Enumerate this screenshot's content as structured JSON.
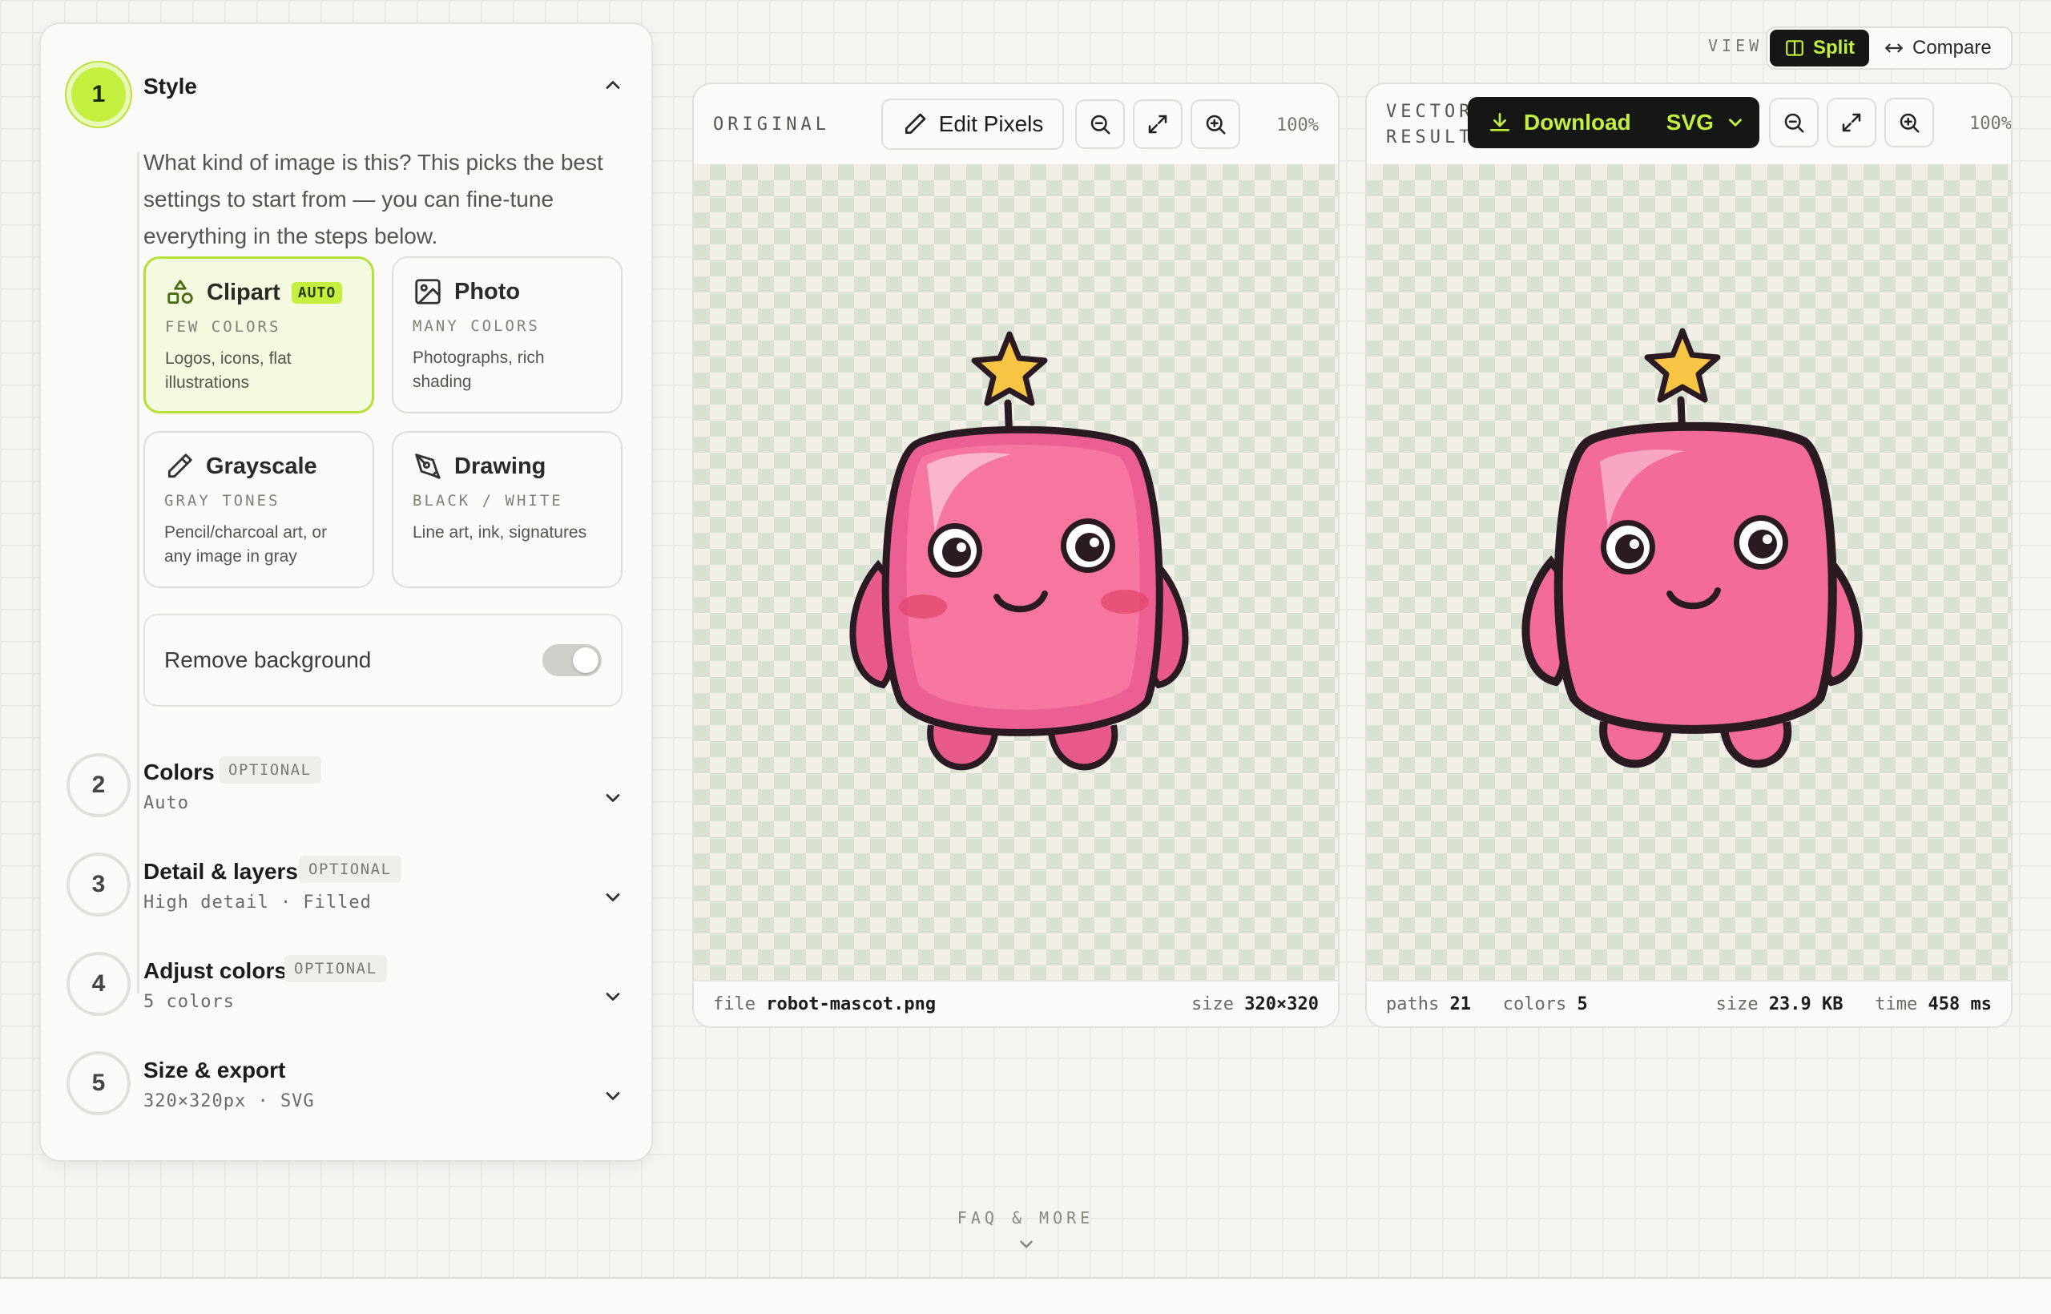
{
  "steps": [
    {
      "number": "1",
      "title": "Style",
      "description": "What kind of image is this? This picks the best settings to start from — you can fine-tune everything in the steps below."
    },
    {
      "number": "2",
      "title": "Colors",
      "badge": "OPTIONAL",
      "summary": "Auto"
    },
    {
      "number": "3",
      "title": "Detail & layers",
      "badge": "OPTIONAL",
      "summary": "High detail · Filled"
    },
    {
      "number": "4",
      "title": "Adjust colors",
      "badge": "OPTIONAL",
      "summary": "5 colors"
    },
    {
      "number": "5",
      "title": "Size & export",
      "summary": "320×320px · SVG"
    }
  ],
  "style_cards": [
    {
      "title": "Clipart",
      "badge": "AUTO",
      "tag": "FEW COLORS",
      "desc": "Logos, icons, flat illustrations",
      "selected": true,
      "icon": "shapes-icon"
    },
    {
      "title": "Photo",
      "tag": "MANY COLORS",
      "desc": "Photographs, rich shading",
      "icon": "image-icon"
    },
    {
      "title": "Grayscale",
      "tag": "GRAY TONES",
      "desc": "Pencil/charcoal art, or any image in gray",
      "icon": "pencil-icon"
    },
    {
      "title": "Drawing",
      "tag": "BLACK / WHITE",
      "desc": "Line art, ink, signatures",
      "icon": "pen-nib-icon"
    }
  ],
  "remove_background": {
    "label": "Remove background",
    "enabled": true
  },
  "view": {
    "label": "VIEW",
    "split": "Split",
    "compare": "Compare",
    "active": "split"
  },
  "original": {
    "label": "ORIGINAL",
    "edit_button": "Edit Pixels",
    "zoom": "100%",
    "file_label": "file",
    "file_name": "robot-mascot.png",
    "size_label": "size",
    "size_value": "320×320"
  },
  "result": {
    "label_line1": "VECTOR",
    "label_line2": "RESULT",
    "download": "Download",
    "format": "SVG",
    "zoom": "100%",
    "paths_label": "paths",
    "paths_value": "21",
    "colors_label": "colors",
    "colors_value": "5",
    "size_label": "size",
    "size_value": "23.9 KB",
    "time_label": "time",
    "time_value": "458 ms"
  },
  "faq": "FAQ & MORE",
  "colors": {
    "accent": "#c4ef3e",
    "dark": "#161614",
    "robot_pink": "#f26b9a",
    "star": "#f7c443"
  }
}
